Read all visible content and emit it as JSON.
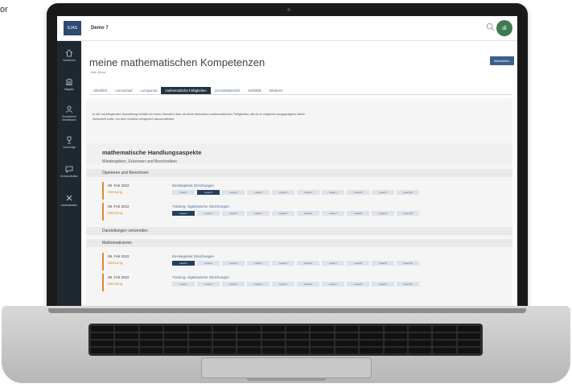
{
  "corner_text": "or",
  "app": {
    "logo_text": "ILIAS",
    "title": "Demo 7",
    "avatar": "di"
  },
  "sidebar": [
    {
      "label": "Dashboard",
      "icon": "home-icon"
    },
    {
      "label": "Magazin",
      "icon": "library-icon"
    },
    {
      "label": "Persönlicher Arbeitsraum",
      "icon": "person-icon"
    },
    {
      "label": "Lernerfolge",
      "icon": "trophy-icon"
    },
    {
      "label": "Kommunikation",
      "icon": "chat-icon"
    },
    {
      "label": "Administration",
      "icon": "tools-icon"
    }
  ],
  "page": {
    "title": "meine mathematischen Kompetenzen",
    "subtitle": "Zeitl, Anna",
    "edit_button": "Bearbeiten",
    "tabs": [
      "Überblick",
      "Lernverlauf",
      "Lernjournal",
      "mathematische Fähigkeiten",
      "Lernzielübersicht",
      "Softskills",
      "Weiteres"
    ],
    "active_tab": "mathematische Fähigkeiten",
    "intro": "In der nachfolgenden Darstellung erhältst du einen Überblick über all deine relevanten mathematischen Fähigkeiten, die du in möglichst ausgeprägtem Maße entwickelt sollst, um dein Studium erfolgreich abzuschließen.",
    "section_title": "mathematische Handlungsaspekte",
    "section_subtitle": "Wiedergeben, Erkennen und Beschreiben",
    "groups": [
      "Operieren und Berechnen",
      "Darstellungen verwenden",
      "Mathematisieren"
    ],
    "entries": [
      {
        "date": "08. Feb 2022",
        "type": "Messung",
        "test": "Einstiegstest Gleichungen",
        "level_on": 2
      },
      {
        "date": "08. Feb 2022",
        "type": "Messung",
        "test": "Training: Algebraische Gleichungen",
        "level_on": 1
      },
      {
        "date": "08. Feb 2022",
        "type": "Messung",
        "test": "Einstiegstest Gleichungen",
        "level_on": 1
      },
      {
        "date": "08. Feb 2022",
        "type": "Messung",
        "test": "Training: Algebraische Gleichungen",
        "level_on": 0
      }
    ],
    "levels": [
      "Level 1",
      "Level 2",
      "Level 3",
      "Level 4",
      "Level 5",
      "Level 6",
      "Level 7",
      "Level 8",
      "Level 9",
      "Level 10"
    ]
  },
  "colors": {
    "accent": "#e08a2e",
    "primary": "#24405f",
    "sidebar": "#1f2731"
  }
}
